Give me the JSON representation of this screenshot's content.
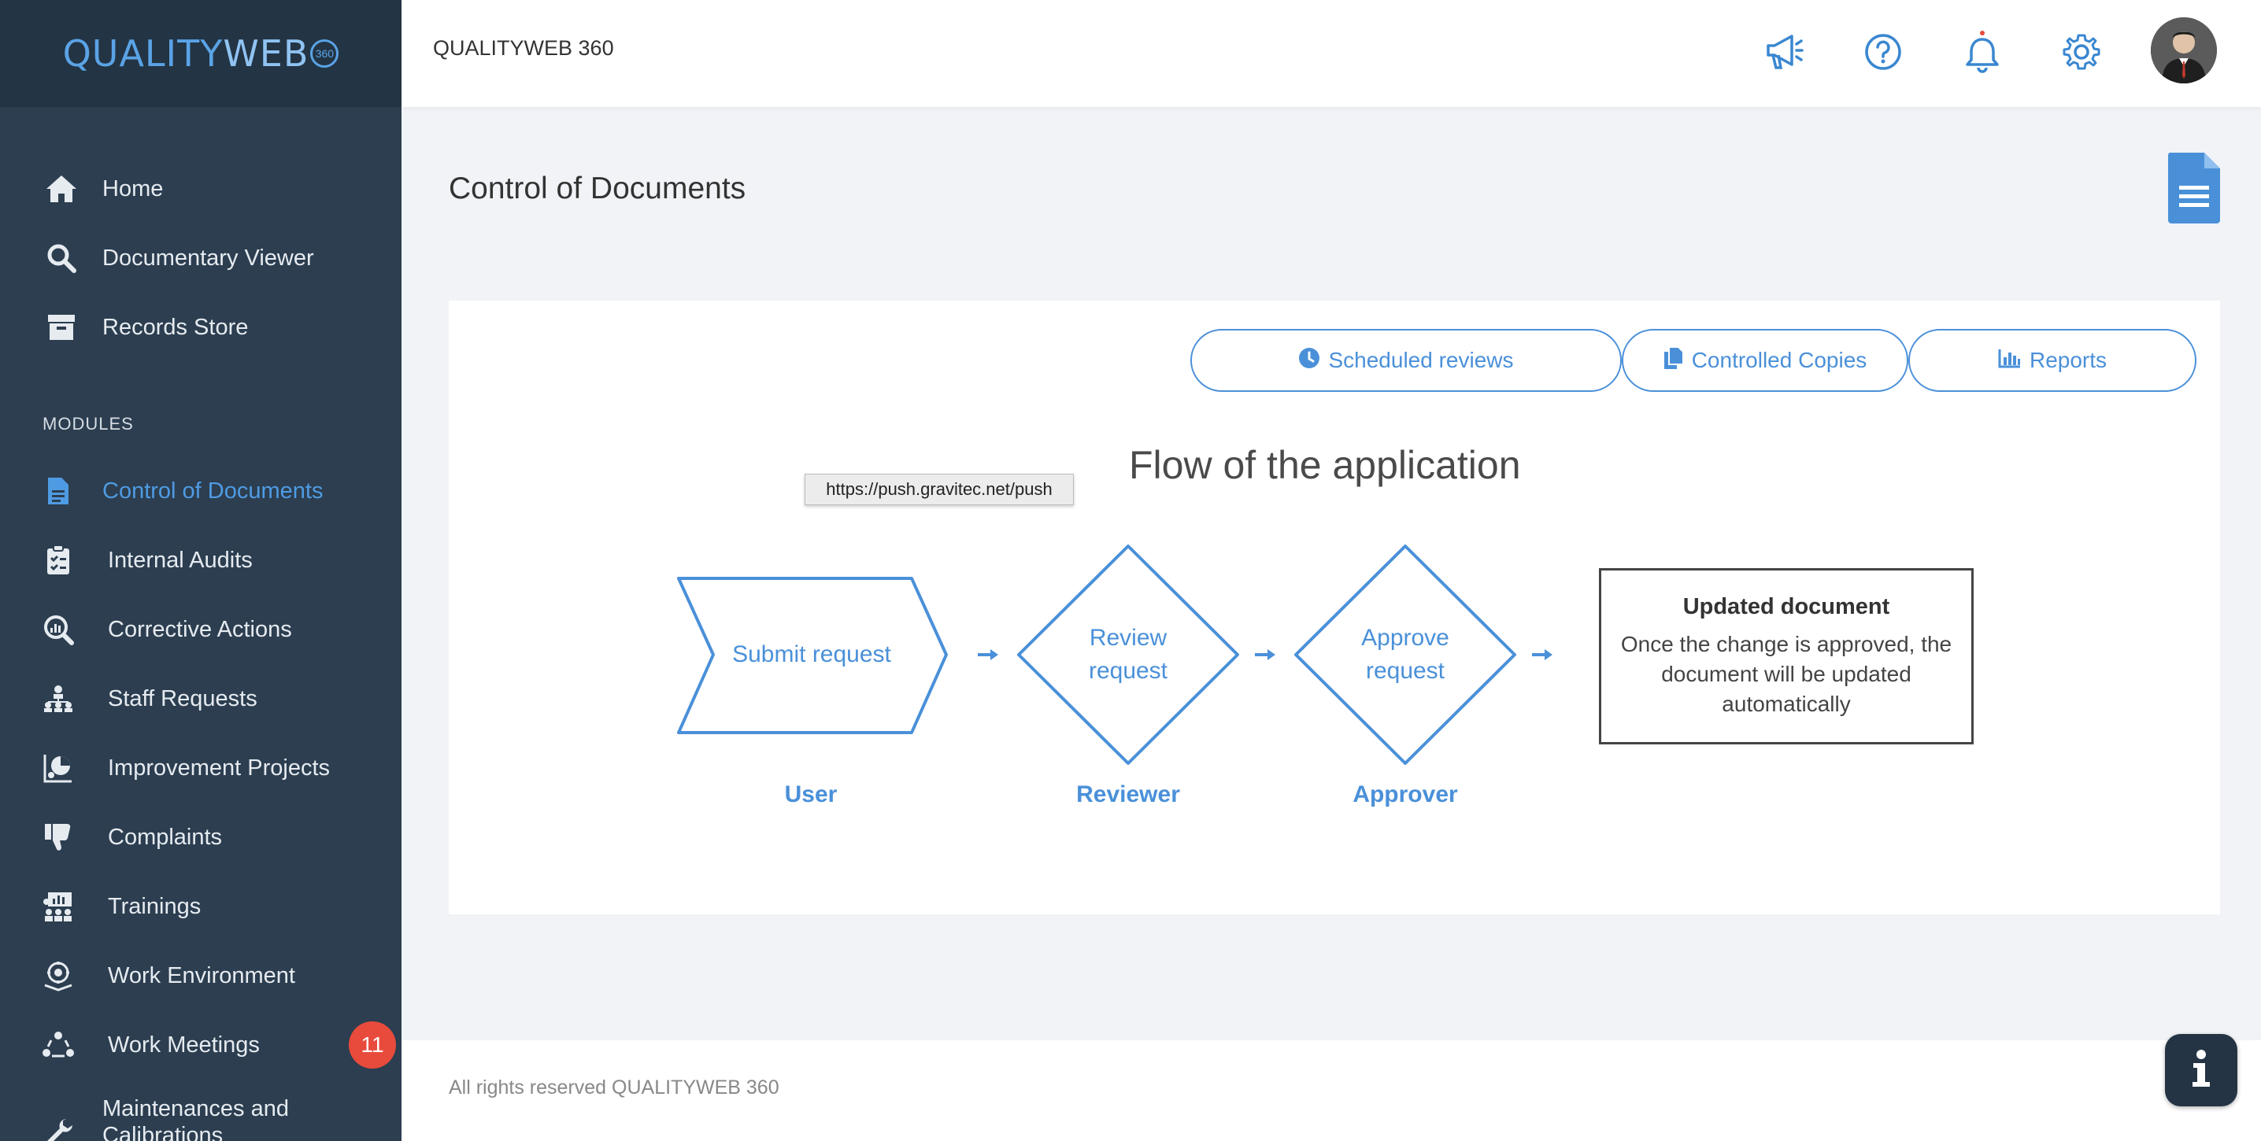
{
  "brand": {
    "name_part1": "QUALITY",
    "name_part2": "WEB",
    "badge": "360"
  },
  "topbar": {
    "title": "QUALITYWEB 360",
    "notification_dot_color": "#e84b3c"
  },
  "sidebar": {
    "items": [
      {
        "label": "Home",
        "icon": "home-icon"
      },
      {
        "label": "Documentary Viewer",
        "icon": "search-icon"
      },
      {
        "label": "Records Store",
        "icon": "archive-icon"
      }
    ],
    "section_label": "MODULES",
    "modules": [
      {
        "label": "Control of Documents",
        "icon": "document-icon",
        "active": true
      },
      {
        "label": "Internal Audits",
        "icon": "clipboard-check-icon"
      },
      {
        "label": "Corrective Actions",
        "icon": "magnify-chart-icon"
      },
      {
        "label": "Staff Requests",
        "icon": "org-chart-icon"
      },
      {
        "label": "Improvement Projects",
        "icon": "project-icon"
      },
      {
        "label": "Complaints",
        "icon": "thumbs-down-icon"
      },
      {
        "label": "Trainings",
        "icon": "training-icon"
      },
      {
        "label": "Work Environment",
        "icon": "environment-icon"
      },
      {
        "label": "Work Meetings",
        "icon": "meeting-icon",
        "badge": "11"
      },
      {
        "label": "Maintenances and Calibrations",
        "icon": "wrench-icon"
      }
    ]
  },
  "page": {
    "title": "Control of Documents"
  },
  "actions": {
    "scheduled_reviews": "Scheduled reviews",
    "controlled_copies": "Controlled Copies",
    "reports": "Reports"
  },
  "flow": {
    "title": "Flow of the application",
    "tooltip": "https://push.gravitec.net/push",
    "steps": [
      {
        "label": "Submit request",
        "role": "User"
      },
      {
        "label": "Review request",
        "role": "Reviewer"
      },
      {
        "label": "Approve request",
        "role": "Approver"
      }
    ],
    "result": {
      "title": "Updated document",
      "text": "Once the change is approved, the document will be updated automatically"
    }
  },
  "footer": {
    "text": "All rights reserved QUALITYWEB 360"
  },
  "colors": {
    "accent": "#4a90d9",
    "sidebar": "#2c3e50",
    "badge": "#e84b3c"
  }
}
